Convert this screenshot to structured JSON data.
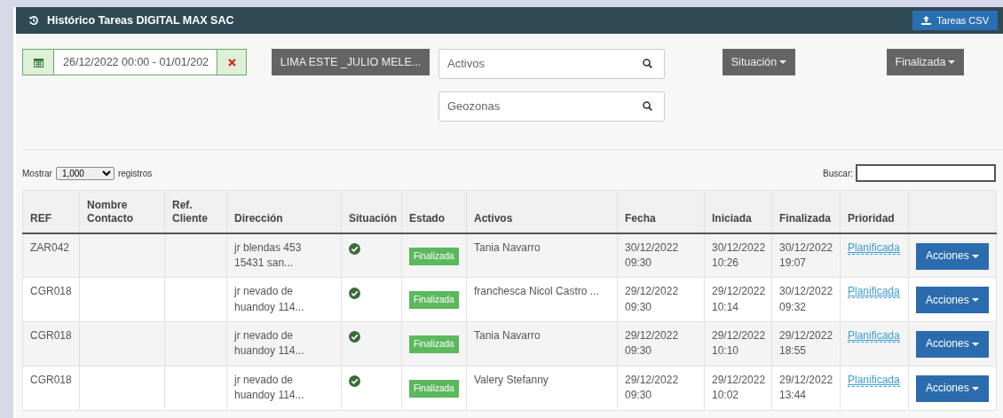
{
  "panel": {
    "title": "Histórico Tareas DIGITAL MAX SAC",
    "export_button": "Tareas CSV"
  },
  "filters": {
    "date_range": "26/12/2022 00:00 - 01/01/202",
    "group_button": "LIMA ESTE _JULIO MELE...",
    "activos": {
      "placeholder": "Activos"
    },
    "geozonas": {
      "placeholder": "Geozonas"
    },
    "situacion_dropdown": "Situación",
    "estado_dropdown": "Finalizada"
  },
  "table_controls": {
    "show_label": "Mostrar",
    "page_size": "1,000",
    "records_label": "registros",
    "search_label": "Buscar:"
  },
  "table": {
    "columns": [
      "REF",
      "Nombre Contacto",
      "Ref. Cliente",
      "Dirección",
      "Situación",
      "Estado",
      "Activos",
      "Fecha",
      "Iniciada",
      "Finalizada",
      "Prioridad"
    ],
    "rows": [
      {
        "ref": "ZAR042",
        "address": "jr blendas 453 15431 san...",
        "estado": "Finalizada",
        "activo": "Tania Navarro",
        "fecha": "30/12/2022 09:30",
        "iniciada": "30/12/2022 10:26",
        "finalizada": "30/12/2022 19:07",
        "prioridad": "Planificada",
        "action": "Acciones"
      },
      {
        "ref": "CGR018",
        "address": "jr nevado de huandoy 114...",
        "estado": "Finalizada",
        "activo": "franchesca Nicol Castro ...",
        "fecha": "29/12/2022 09:30",
        "iniciada": "29/12/2022 10:14",
        "finalizada": "30/12/2022 09:32",
        "prioridad": "Planificada",
        "action": "Acciones"
      },
      {
        "ref": "CGR018",
        "address": "jr nevado de huandoy 114...",
        "estado": "Finalizada",
        "activo": "Tania Navarro",
        "fecha": "29/12/2022 09:30",
        "iniciada": "29/12/2022 10:10",
        "finalizada": "29/12/2022 18:55",
        "prioridad": "Planificada",
        "action": "Acciones"
      },
      {
        "ref": "CGR018",
        "address": "jr nevado de huandoy 114...",
        "estado": "Finalizada",
        "activo": "Valery Stefanny",
        "fecha": "29/12/2022 09:30",
        "iniciada": "29/12/2022 10:02",
        "finalizada": "29/12/2022 13:44",
        "prioridad": "Planificada",
        "action": "Acciones"
      }
    ]
  }
}
